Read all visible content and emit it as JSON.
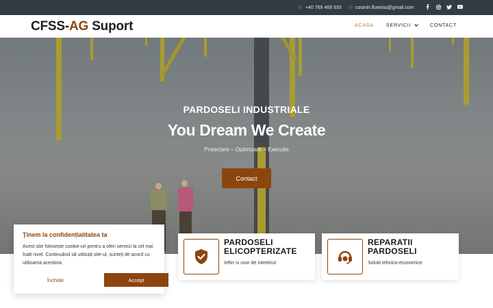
{
  "topbar": {
    "phone": "+40 769 469 933",
    "email": "cosmin.flueiras@gmail.com",
    "social": [
      "facebook-icon",
      "instagram-icon",
      "twitter-icon",
      "youtube-icon"
    ]
  },
  "header": {
    "logo_part1": "CFSS-",
    "logo_part2": "AG",
    "logo_part3": " Suport",
    "nav": {
      "home": "ACASA",
      "services": "SERVICII",
      "contact": "CONTACT"
    }
  },
  "hero": {
    "kicker": "PARDOSELI INDUSTRIALE",
    "title": "You Dream We Create",
    "subtitle": "Proiectare – Optimizare – Executie",
    "button": "Contact"
  },
  "cards": [
    {
      "title_line1": "PARDOSELI",
      "title_line2": "ELICOPTERIZATE",
      "desc": "Ieftin si usor de intretinut",
      "icon": "shield-check-icon"
    },
    {
      "title_line1": "REPARATII",
      "title_line2": "PARDOSELI",
      "desc": "Solutii tehnico-economice",
      "icon": "headset-icon"
    }
  ],
  "cookie": {
    "title": "Ținem la confidențialitatea ta",
    "text": "Acest site folosește cookie-uri pentru a oferi servicii la cel mai înalt nivel. Continuând să utilizați site-ul, sunteți de acord cu utilizarea acestora.",
    "close": "Închide",
    "accept": "Accept"
  },
  "colors": {
    "accent": "#8c450f",
    "active_nav": "#b8741f",
    "topbar": "#323c44"
  }
}
